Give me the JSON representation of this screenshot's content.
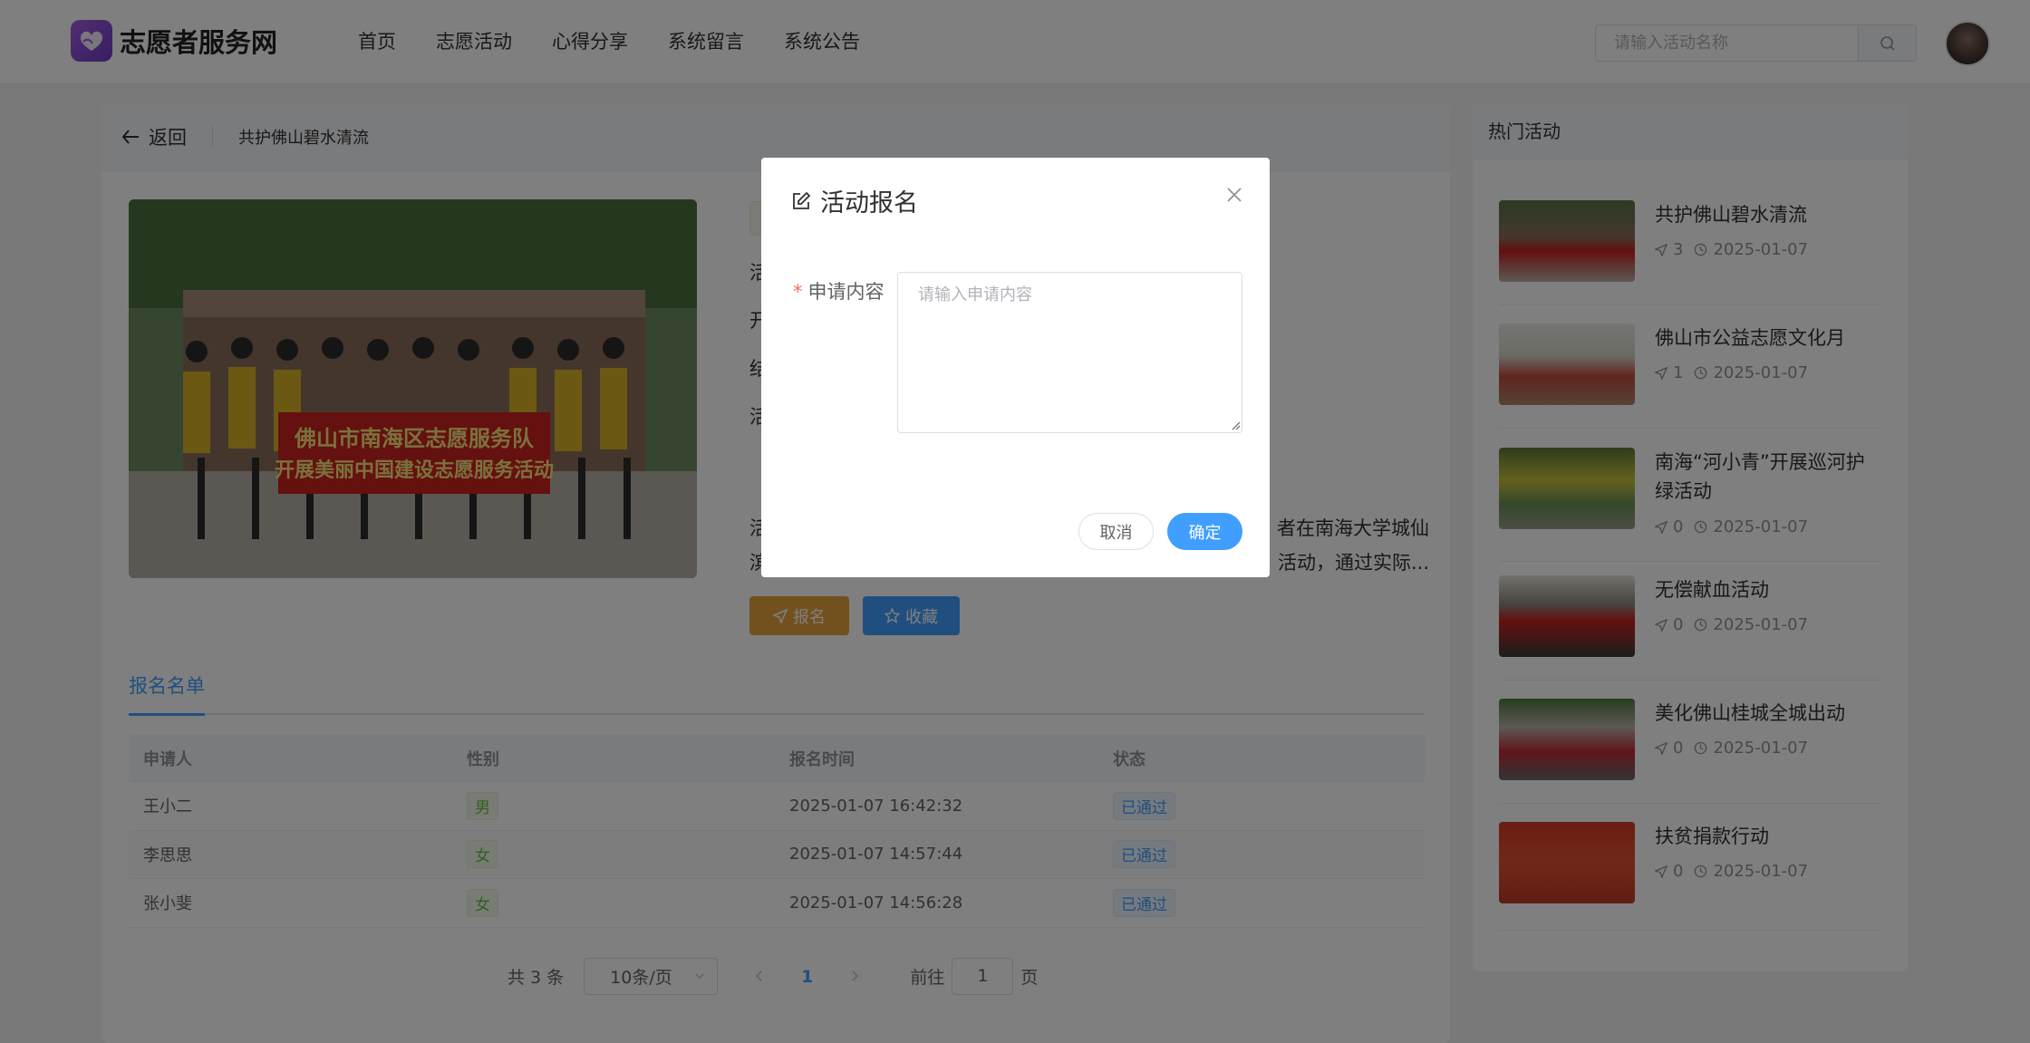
{
  "header": {
    "site_name": "志愿者服务网",
    "nav": [
      "首页",
      "志愿活动",
      "心得分享",
      "系统留言",
      "系统公告"
    ],
    "search_placeholder": "请输入活动名称"
  },
  "main": {
    "back_label": "返回",
    "activity_title": "共护佛山碧水清流",
    "detail_lines": [
      "活",
      "开",
      "结",
      "活"
    ],
    "desc_prefix_1": "活",
    "desc_prefix_2": "滨",
    "desc_suffix_1": "者在南海大学城仙",
    "desc_suffix_2": "活动，通过实际...",
    "signup_label": "报名",
    "favorite_label": "收藏",
    "tab_label": "报名名单",
    "table": {
      "headers": [
        "申请人",
        "性别",
        "报名时间",
        "状态"
      ],
      "rows": [
        {
          "name": "王小二",
          "sex": "男",
          "time": "2025-01-07 16:42:32",
          "status": "已通过"
        },
        {
          "name": "李思思",
          "sex": "女",
          "time": "2025-01-07 14:57:44",
          "status": "已通过"
        },
        {
          "name": "张小斐",
          "sex": "女",
          "time": "2025-01-07 14:56:28",
          "status": "已通过"
        }
      ]
    },
    "pager": {
      "total": "共 3 条",
      "page_size": "10条/页",
      "current": "1",
      "goto_label": "前往",
      "goto_value": "1",
      "page_suffix": "页"
    }
  },
  "sidebar": {
    "title": "热门活动",
    "items": [
      {
        "title": "共护佛山碧水清流",
        "count": "3",
        "date": "2025-01-07"
      },
      {
        "title": "佛山市公益志愿文化月",
        "count": "1",
        "date": "2025-01-07"
      },
      {
        "title": "南海“河小青”开展巡河护绿活动",
        "count": "0",
        "date": "2025-01-07"
      },
      {
        "title": "无偿献血活动",
        "count": "0",
        "date": "2025-01-07"
      },
      {
        "title": "美化佛山桂城全城出动",
        "count": "0",
        "date": "2025-01-07"
      },
      {
        "title": "扶贫捐款行动",
        "count": "0",
        "date": "2025-01-07"
      }
    ]
  },
  "dialog": {
    "title": "活动报名",
    "field_label": "申请内容",
    "required_mark": "*",
    "placeholder": "请输入申请内容",
    "cancel": "取消",
    "confirm": "确定"
  },
  "photo_banner": {
    "line1": "佛山市南海区志愿服务队",
    "line2": "开展美丽中国建设志愿服务活动"
  },
  "colors": {
    "primary": "#409eff",
    "warning": "#e6a23c",
    "success": "#67c23a",
    "danger": "#f56c6c"
  }
}
